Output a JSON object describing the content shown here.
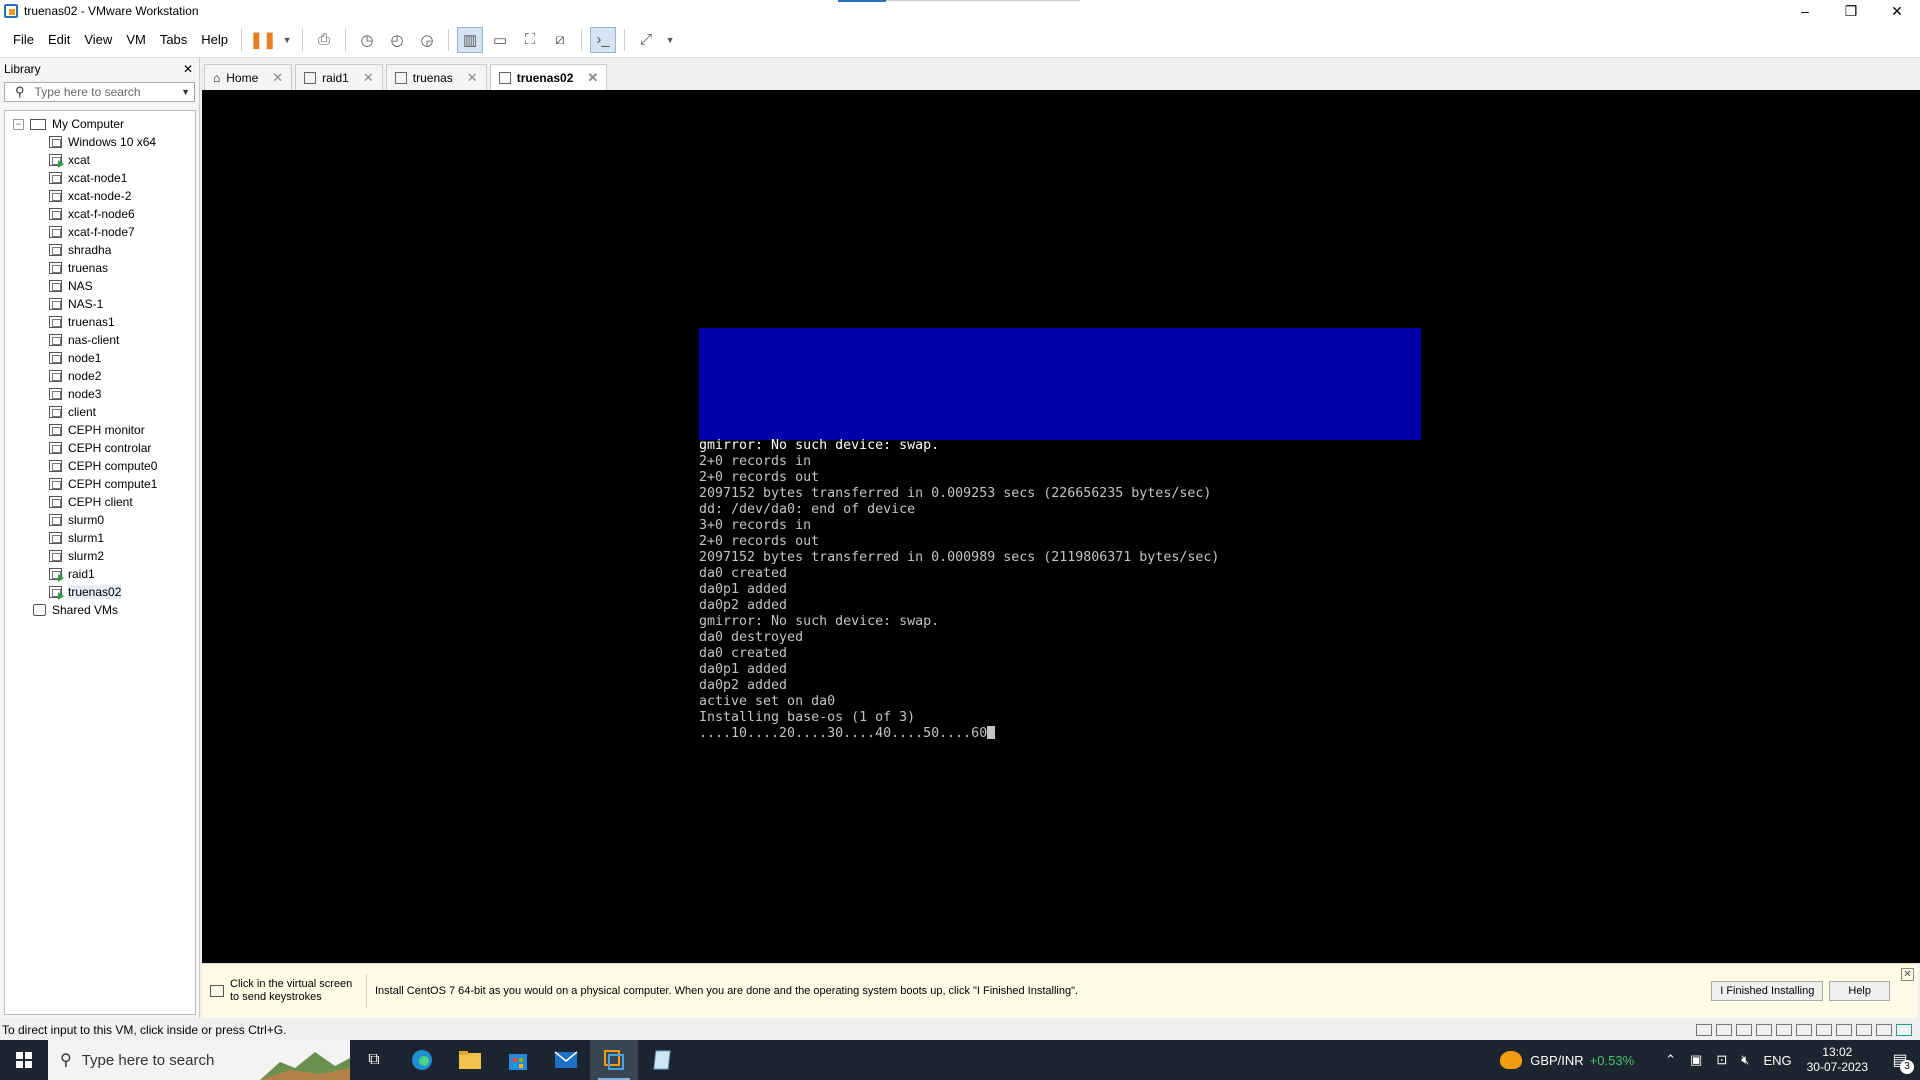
{
  "window": {
    "title": "truenas02 - VMware Workstation"
  },
  "menu": [
    "File",
    "Edit",
    "View",
    "VM",
    "Tabs",
    "Help"
  ],
  "library": {
    "title": "Library",
    "search_placeholder": "Type here to search",
    "root": "My Computer",
    "vms": [
      "Windows 10 x64",
      "xcat",
      "xcat-node1",
      "xcat-node-2",
      "xcat-f-node6",
      "xcat-f-node7",
      "shradha",
      "truenas",
      "NAS",
      "NAS-1",
      "truenas1",
      "nas-client",
      "node1",
      "node2",
      "node3",
      "client",
      "CEPH monitor",
      "CEPH controlar",
      "CEPH compute0",
      "CEPH compute1",
      "CEPH client",
      "slurm0",
      "slurm1",
      "slurm2",
      "raid1",
      "truenas02"
    ],
    "shared": "Shared VMs"
  },
  "tabs": [
    {
      "label": "Home"
    },
    {
      "label": "raid1"
    },
    {
      "label": "truenas"
    },
    {
      "label": "truenas02"
    }
  ],
  "console_lines": [
    "gmirror: No such device: swap.",
    "2+0 records in",
    "2+0 records out",
    "2097152 bytes transferred in 0.009253 secs (226656235 bytes/sec)",
    "dd: /dev/da0: end of device",
    "3+0 records in",
    "2+0 records out",
    "2097152 bytes transferred in 0.000989 secs (2119806371 bytes/sec)",
    "da0 created",
    "da0p1 added",
    "da0p2 added",
    "gmirror: No such device: swap.",
    "da0 destroyed",
    "da0 created",
    "da0p1 added",
    "da0p2 added",
    "active set on da0",
    "Installing base-os (1 of 3)",
    "....10....20....30....40....50....60"
  ],
  "hint": {
    "send_keystrokes": "Click in the virtual screen to send keystrokes",
    "message": "Install CentOS 7 64-bit as you would on a physical computer. When you are done and the operating system boots up, click \"I Finished Installing\".",
    "finished_button": "I Finished Installing",
    "help_button": "Help"
  },
  "status": {
    "text": "To direct input to this VM, click inside or press Ctrl+G."
  },
  "taskbar": {
    "search_placeholder": "Type here to search",
    "ticker_symbol": "GBP/INR",
    "ticker_change": "+0.53%",
    "language": "ENG",
    "time": "13:02",
    "date": "30-07-2023",
    "notification_count": "3"
  },
  "colors": {
    "console_bg": "#000000",
    "installer_blue": "#0000aa",
    "hint_bg": "#fffbe6",
    "taskbar_bg": "#1c2530"
  }
}
